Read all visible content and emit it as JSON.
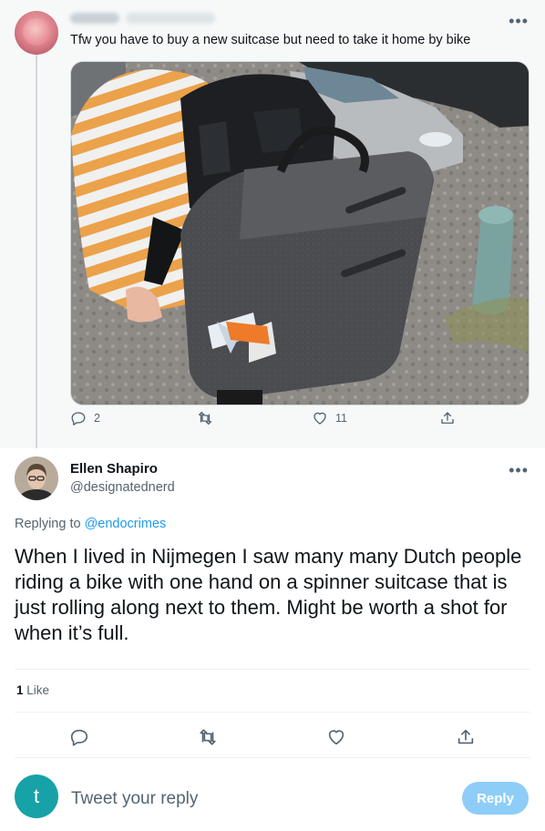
{
  "parent_tweet": {
    "text": "Tfw you have to buy a new suitcase but need to take it home by bike",
    "photo_icon": "photo-suitcase-on-back",
    "actions": {
      "reply_count": "2",
      "retweet_count": "",
      "like_count": "11",
      "share_count": ""
    }
  },
  "reply_tweet": {
    "author_name": "Ellen Shapiro",
    "author_handle": "@designatednerd",
    "replying_to_prefix": "Replying to",
    "replying_to_handle": "@endocrimes",
    "text": "When I lived in Nijmegen I saw many many Dutch people riding a bike with one hand on a spinner suitcase that is just rolling along next to them. Might be worth a shot for when it’s full.",
    "like_count": "1",
    "like_label": "Like"
  },
  "compose": {
    "avatar_letter": "t",
    "placeholder": "Tweet your reply",
    "button_label": "Reply"
  },
  "colors": {
    "accent": "#1d9bf0",
    "reply_button_disabled": "#8ecdf8",
    "muted_text": "#536471",
    "compose_avatar": "#17a2a7"
  }
}
